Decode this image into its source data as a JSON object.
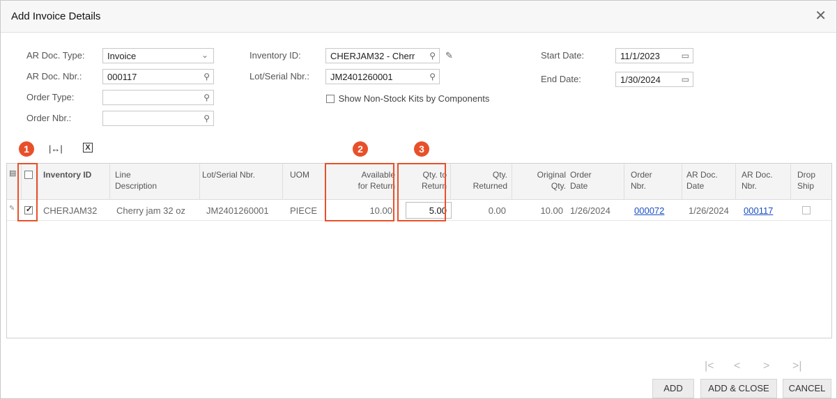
{
  "dialog": {
    "title": "Add Invoice Details"
  },
  "form": {
    "ar_doc_type": {
      "label": "AR Doc. Type:",
      "value": "Invoice"
    },
    "ar_doc_nbr": {
      "label": "AR Doc. Nbr.:",
      "value": "000117"
    },
    "order_type": {
      "label": "Order Type:",
      "value": ""
    },
    "order_nbr": {
      "label": "Order Nbr.:",
      "value": ""
    },
    "inventory_id": {
      "label": "Inventory ID:",
      "value": "CHERJAM32 - Cherr"
    },
    "lot_serial_nbr": {
      "label": "Lot/Serial Nbr.:",
      "value": "JM2401260001"
    },
    "show_nonstock": {
      "label": "Show Non-Stock Kits by Components",
      "checked": false
    },
    "start_date": {
      "label": "Start Date:",
      "value": "11/1/2023"
    },
    "end_date": {
      "label": "End Date:",
      "value": "1/30/2024"
    }
  },
  "callouts": [
    "1",
    "2",
    "3"
  ],
  "grid": {
    "headers": {
      "inventory_id": "Inventory ID",
      "line_desc_1": "Line",
      "line_desc_2": "Description",
      "lot_serial": "Lot/Serial Nbr.",
      "uom": "UOM",
      "avail_1": "Available",
      "avail_2": "for Return",
      "qty_to_return_1": "Qty. to",
      "qty_to_return_2": "Return",
      "qty_returned_1": "Qty.",
      "qty_returned_2": "Returned",
      "orig_qty_1": "Original",
      "orig_qty_2": "Qty.",
      "order_date_1": "Order",
      "order_date_2": "Date",
      "order_nbr_1": "Order",
      "order_nbr_2": "Nbr.",
      "ar_doc_date_1": "AR Doc.",
      "ar_doc_date_2": "Date",
      "ar_doc_nbr_1": "AR Doc.",
      "ar_doc_nbr_2": "Nbr.",
      "drop_ship_1": "Drop",
      "drop_ship_2": "Ship"
    },
    "rows": [
      {
        "selected": true,
        "inventory_id": "CHERJAM32",
        "line_description": "Cherry jam 32 oz",
        "lot_serial": "JM2401260001",
        "uom": "PIECE",
        "available_for_return": "10.00",
        "qty_to_return": "5.00",
        "qty_returned": "0.00",
        "original_qty": "10.00",
        "order_date": "1/26/2024",
        "order_nbr": "000072",
        "ar_doc_date": "1/26/2024",
        "ar_doc_nbr": "000117",
        "drop_ship": false
      }
    ]
  },
  "pager": {
    "first": "|<",
    "prev": "<",
    "next": ">",
    "last": ">|"
  },
  "buttons": {
    "add": "ADD",
    "add_close": "ADD & CLOSE",
    "cancel": "CANCEL"
  },
  "colors": {
    "accent": "#e8502a",
    "link": "#1a4fc4"
  }
}
